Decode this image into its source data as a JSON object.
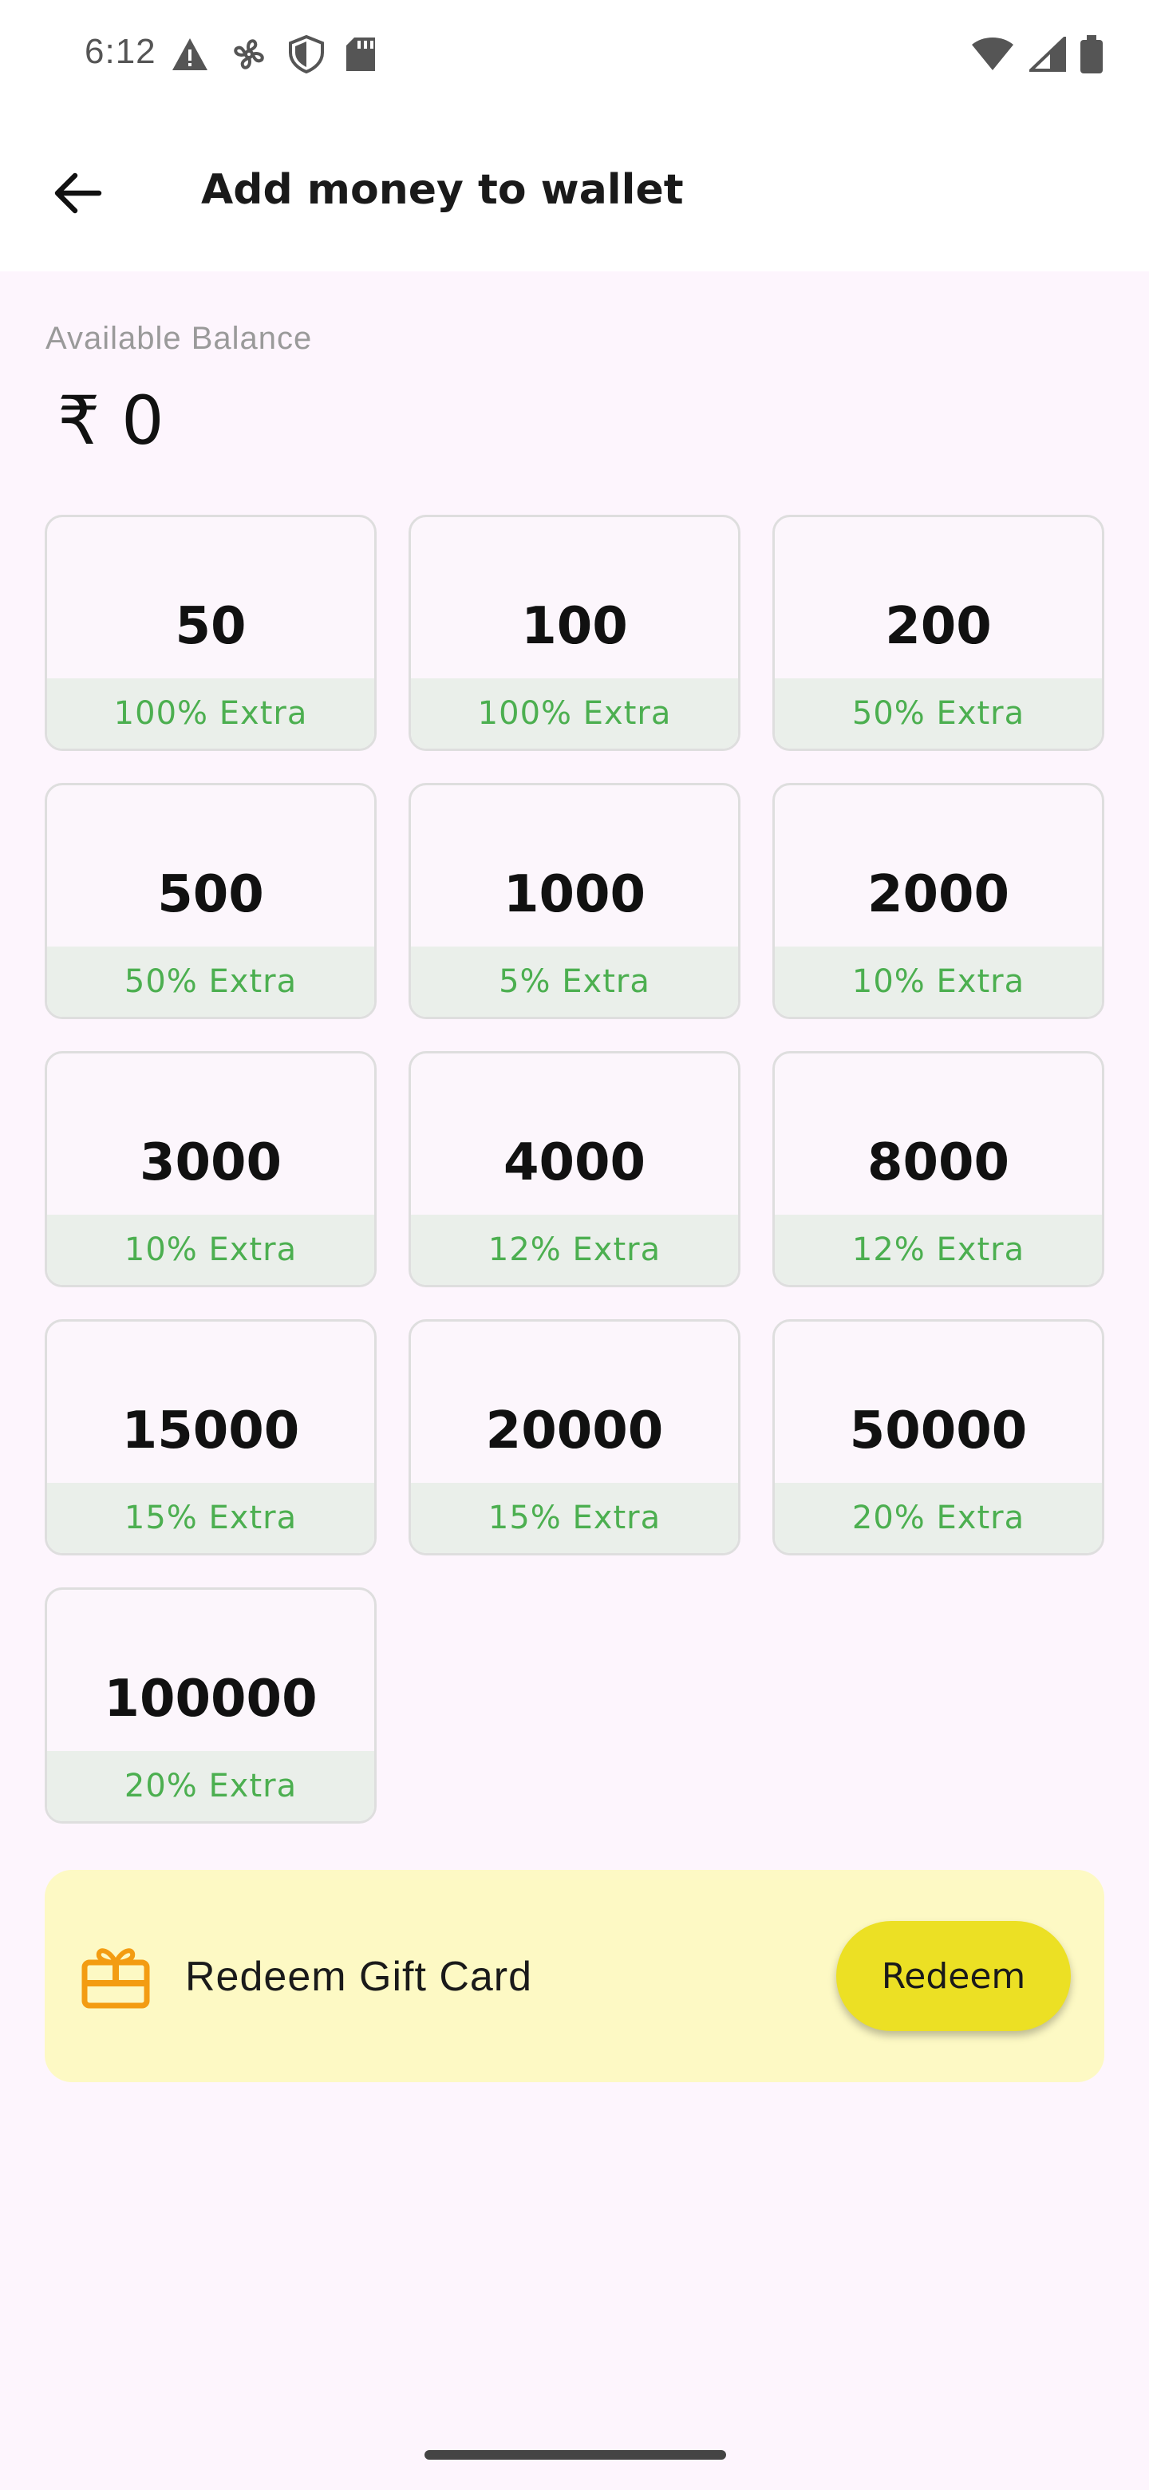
{
  "status_bar": {
    "time": "6:12",
    "left_icons": [
      "warning-icon",
      "fan-icon",
      "shield-icon",
      "sd-card-icon"
    ],
    "right_icons": [
      "wifi-icon",
      "cell-signal-icon",
      "battery-icon"
    ]
  },
  "header": {
    "back_icon": "arrow-left-icon",
    "title": "Add money to wallet"
  },
  "balance": {
    "label": "Available Balance",
    "value": "₹ 0"
  },
  "amount_options": [
    {
      "amount": "50",
      "extra": "100% Extra"
    },
    {
      "amount": "100",
      "extra": "100% Extra"
    },
    {
      "amount": "200",
      "extra": "50% Extra"
    },
    {
      "amount": "500",
      "extra": "50% Extra"
    },
    {
      "amount": "1000",
      "extra": "5% Extra"
    },
    {
      "amount": "2000",
      "extra": "10% Extra"
    },
    {
      "amount": "3000",
      "extra": "10% Extra"
    },
    {
      "amount": "4000",
      "extra": "12% Extra"
    },
    {
      "amount": "8000",
      "extra": "12% Extra"
    },
    {
      "amount": "15000",
      "extra": "15% Extra"
    },
    {
      "amount": "20000",
      "extra": "15% Extra"
    },
    {
      "amount": "50000",
      "extra": "20% Extra"
    },
    {
      "amount": "100000",
      "extra": "20% Extra"
    }
  ],
  "gift_card": {
    "icon": "gift-card-icon",
    "label": "Redeem Gift Card",
    "button_label": "Redeem"
  },
  "colors": {
    "background": "#fdf5fd",
    "extra_text": "#4caf50",
    "gift_card_bg": "#fdf9c4",
    "redeem_button": "#ece024",
    "gift_icon": "#f39c12"
  }
}
